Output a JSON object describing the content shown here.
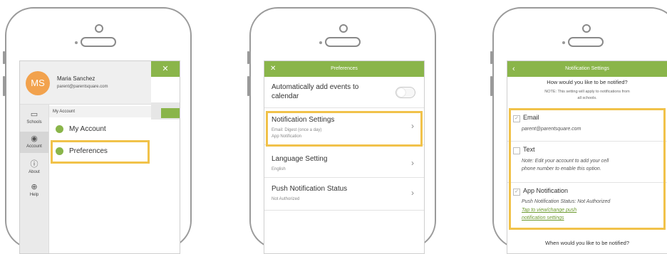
{
  "phone1": {
    "user": {
      "initials": "MS",
      "name": "Maria Sanchez",
      "email": "parent@parentsquare.com"
    },
    "rail": [
      {
        "label": "Schools",
        "icon": "schools-icon"
      },
      {
        "label": "Account",
        "icon": "account-icon"
      },
      {
        "label": "About",
        "icon": "info-icon"
      },
      {
        "label": "Help",
        "icon": "globe-icon"
      }
    ],
    "section_label": "My Account",
    "menu": [
      {
        "label": "My Account"
      },
      {
        "label": "Preferences"
      }
    ],
    "overlay_close": "✕"
  },
  "phone2": {
    "title": "Preferences",
    "close": "✕",
    "rows": [
      {
        "title": "Automatically add events to calendar"
      },
      {
        "title": "Notification Settings",
        "sub1": "Email: Digest (once a day)",
        "sub2": "App Notification"
      },
      {
        "title": "Language Setting",
        "sub1": "English"
      },
      {
        "title": "Push Notification Status",
        "sub1": "Not Authorized"
      }
    ],
    "chevron": "›"
  },
  "phone3": {
    "title": "Notification Settings",
    "back": "‹",
    "question": "How would you like to be notified?",
    "note1": "NOTE: This setting will apply to notifications from",
    "note2": "all schools.",
    "email": {
      "label": "Email",
      "value": "parent@parentsquare.com"
    },
    "text": {
      "label": "Text",
      "note1": "Note: Edit your account to add your cell",
      "note2": "phone number to enable this option."
    },
    "app": {
      "label": "App Notification",
      "status": "Push Notification Status: Not Authorized",
      "link1": "Tap to view/change push",
      "link2": "notification settings"
    },
    "when": "When would you like to be notified?",
    "check": "✓"
  },
  "colors": {
    "accent_green": "#8ab54a",
    "highlight": "#f1c24a",
    "avatar": "#f2a24d"
  }
}
